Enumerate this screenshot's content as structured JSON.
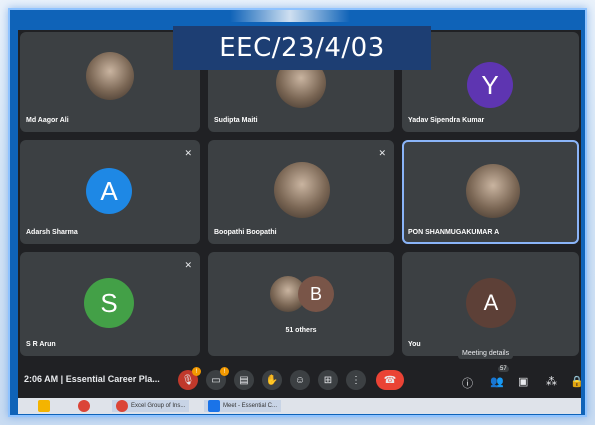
{
  "banner": {
    "code": "EEC/23/4/03"
  },
  "tiles": [
    {
      "name": "Md Aagor Ali",
      "avatar_letter": "",
      "avatar_color": ""
    },
    {
      "name": "Sudipta Maiti",
      "avatar_letter": "",
      "avatar_color": ""
    },
    {
      "name": "Yadav Sipendra Kumar",
      "avatar_letter": "Y",
      "avatar_color": "#5e35b1"
    },
    {
      "name": "Adarsh Sharma",
      "avatar_letter": "A",
      "avatar_color": "#1e88e5"
    },
    {
      "name": "Boopathi Boopathi",
      "avatar_letter": "",
      "avatar_color": ""
    },
    {
      "name": "PON SHANMUGAKUMAR A",
      "avatar_letter": "",
      "avatar_color": ""
    },
    {
      "name": "S R Arun",
      "avatar_letter": "S",
      "avatar_color": "#43a047"
    },
    {
      "name": "51 others",
      "avatar_letter": "B",
      "avatar_color": "#795548"
    },
    {
      "name": "You",
      "avatar_letter": "A",
      "avatar_color": "#5d4037"
    }
  ],
  "bottom_bar": {
    "time_and_meeting": "2:06 AM | Essential Career Pla...",
    "tooltip": "Meeting details",
    "people_count": "57",
    "mic_badge": "!",
    "cam_badge": "!"
  },
  "taskbar": {
    "item1": "Excel Group of Ins...",
    "item2": "Meet - Essential C..."
  }
}
